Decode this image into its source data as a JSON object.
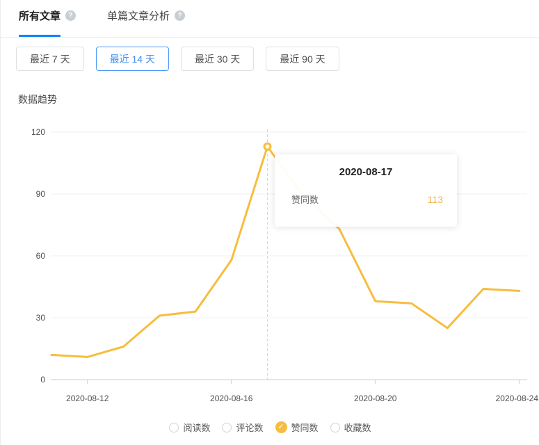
{
  "tabs": {
    "all_articles": "所有文章",
    "single_article": "单篇文章分析",
    "help_glyph": "?"
  },
  "range_buttons": [
    {
      "label": "最近 7 天",
      "selected": false
    },
    {
      "label": "最近 14 天",
      "selected": true
    },
    {
      "label": "最近 30 天",
      "selected": false
    },
    {
      "label": "最近 90 天",
      "selected": false
    }
  ],
  "section_title": "数据趋势",
  "tooltip": {
    "title": "2020-08-17",
    "label": "赞同数",
    "value": "113"
  },
  "colors": {
    "accent_blue": "#0a85f8",
    "selected_button_blue": "#4190f2",
    "line_amber": "#f6bd3e",
    "tooltip_value_amber": "#f5b04a",
    "grid_light": "#f0f0f0",
    "axis_gray": "#cccccc"
  },
  "chart_data": {
    "type": "line",
    "title": "数据趋势",
    "series_name": "赞同数",
    "x": [
      "2020-08-11",
      "2020-08-12",
      "2020-08-13",
      "2020-08-14",
      "2020-08-15",
      "2020-08-16",
      "2020-08-17",
      "2020-08-18",
      "2020-08-19",
      "2020-08-20",
      "2020-08-21",
      "2020-08-22",
      "2020-08-23",
      "2020-08-24"
    ],
    "values": [
      12,
      11,
      16,
      31,
      33,
      58,
      113,
      89,
      73,
      38,
      37,
      25,
      44,
      43
    ],
    "x_tick_labels": [
      "2020-08-12",
      "2020-08-16",
      "2020-08-20",
      "2020-08-24"
    ],
    "y_ticks": [
      0,
      30,
      60,
      90,
      120
    ],
    "ylim": [
      0,
      120
    ],
    "grid": true,
    "legend_position": "bottom",
    "highlight": {
      "x": "2020-08-17",
      "value": 113
    },
    "legend": [
      {
        "label": "阅读数",
        "checked": false
      },
      {
        "label": "评论数",
        "checked": false
      },
      {
        "label": "赞同数",
        "checked": true
      },
      {
        "label": "收藏数",
        "checked": false
      }
    ],
    "check_glyph": "✓"
  }
}
